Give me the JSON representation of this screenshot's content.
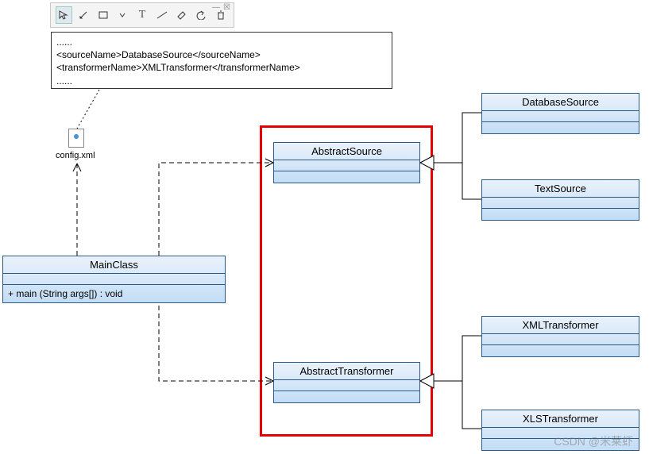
{
  "toolbar": {
    "tools": [
      "pointer",
      "edit",
      "rect",
      "dropdown",
      "text",
      "connector",
      "erase",
      "undo",
      "delete"
    ]
  },
  "note": {
    "line0": "......",
    "line1": "<sourceName>DatabaseSource</sourceName>",
    "line2": "<transformerName>XMLTransformer</transformerName>",
    "line3": "......"
  },
  "file": {
    "name": "config.xml"
  },
  "classes": {
    "main": {
      "name": "MainClass",
      "op": "+ main (String args[]) : void"
    },
    "abstractSource": {
      "name": "AbstractSource"
    },
    "abstractTransformer": {
      "name": "AbstractTransformer"
    },
    "databaseSource": {
      "name": "DatabaseSource"
    },
    "textSource": {
      "name": "TextSource"
    },
    "xmlTransformer": {
      "name": "XMLTransformer"
    },
    "xlsTransformer": {
      "name": "XLSTransformer"
    }
  },
  "watermark": "CSDN @米莱虾"
}
